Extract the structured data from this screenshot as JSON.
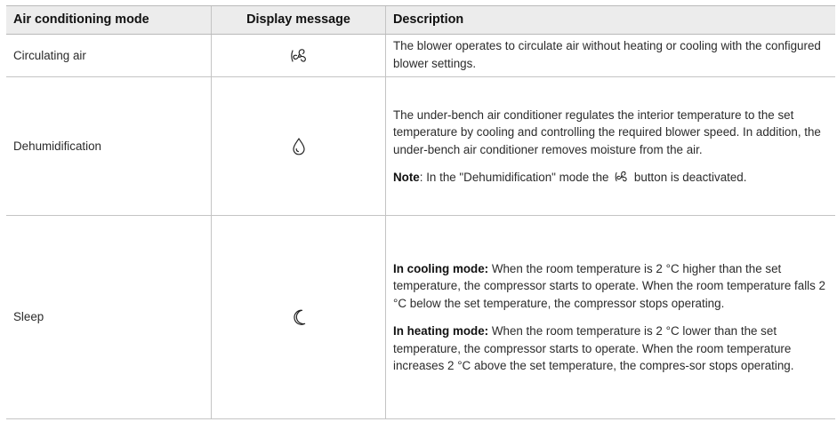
{
  "table": {
    "headers": {
      "mode": "Air conditioning mode",
      "display": "Display message",
      "description": "Description"
    },
    "rows": [
      {
        "mode": "Circulating air",
        "icon": "fan-icon",
        "description": "The blower operates to circulate air without heating or cooling with the configured blower settings."
      },
      {
        "mode": "Dehumidification",
        "icon": "water-drop-icon",
        "description": "The under-bench air conditioner regulates the interior temperature to the set temperature by cooling and controlling the required blower speed. In addition, the under-bench air conditioner removes moisture from the air.",
        "note_label": "Note",
        "note_before": ": In the \"Dehumidification\" mode the ",
        "note_icon": "fan-icon",
        "note_after": " button is deactivated."
      },
      {
        "mode": "Sleep",
        "icon": "moon-icon",
        "cooling_label": "In cooling mode:",
        "cooling_text": " When the room temperature is 2 °C higher than the set temperature, the compressor starts to operate. When the room temperature falls 2 °C below the set temperature, the compressor stops operating.",
        "heating_label": "In heating mode:",
        "heating_text": " When the room temperature is 2 °C lower than the set temperature, the compressor starts to operate. When the room temperature increases 2 °C above the set temperature, the compres-sor stops operating."
      }
    ]
  }
}
